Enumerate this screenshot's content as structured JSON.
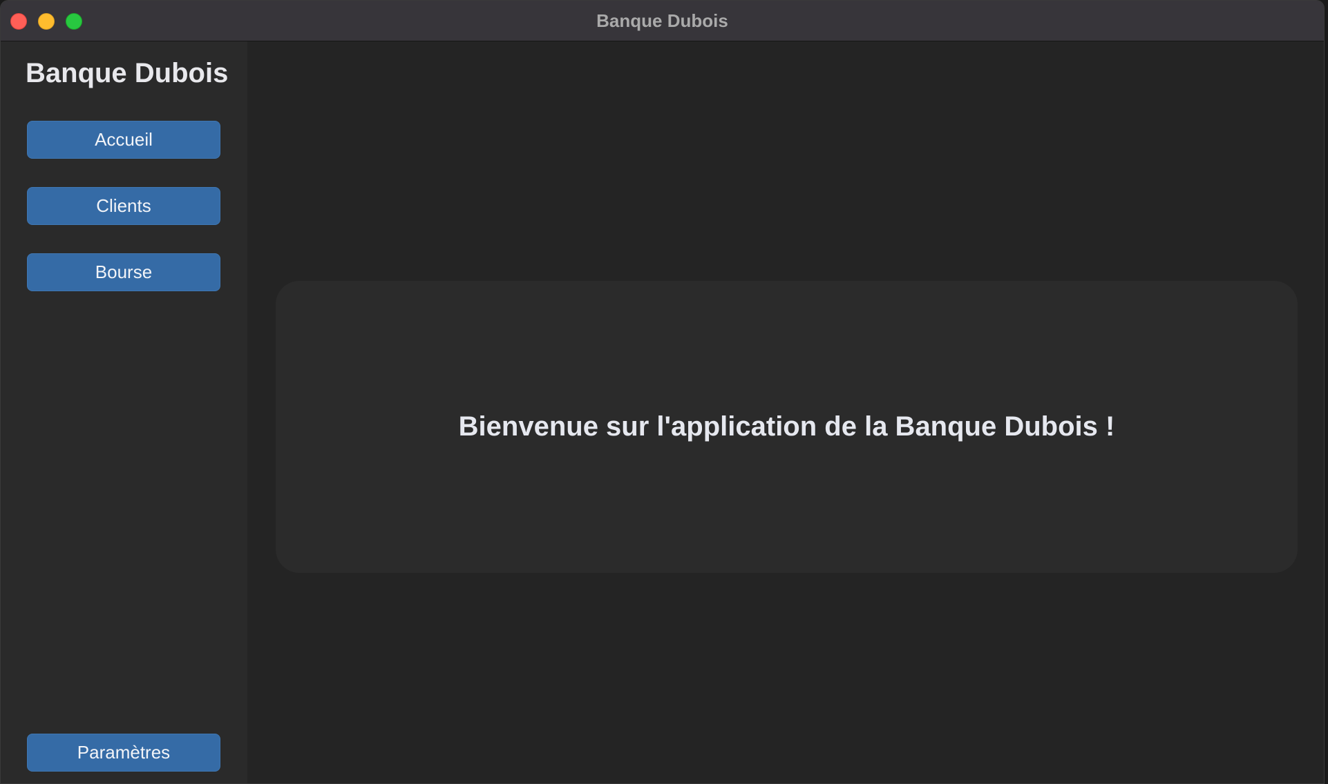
{
  "window": {
    "title": "Banque Dubois"
  },
  "sidebar": {
    "title": "Banque Dubois",
    "items": [
      {
        "label": "Accueil"
      },
      {
        "label": "Clients"
      },
      {
        "label": "Bourse"
      }
    ],
    "settings_label": "Paramètres"
  },
  "main": {
    "welcome": "Bienvenue sur l'application de la Banque Dubois !"
  },
  "colors": {
    "sidebar_bg": "#2a2a2a",
    "main_bg": "#242424",
    "button_bg": "#356ba6",
    "card_bg": "#2b2b2b"
  }
}
